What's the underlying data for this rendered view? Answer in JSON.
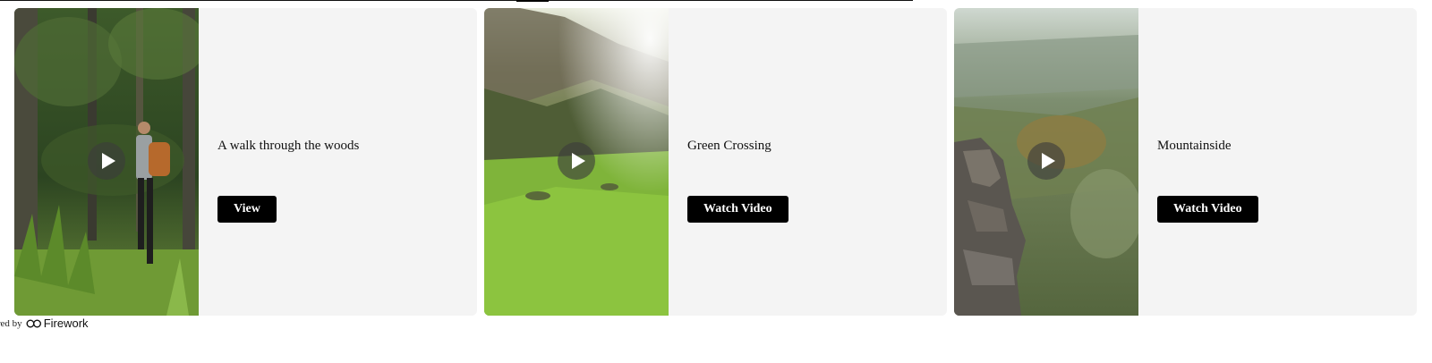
{
  "cards": [
    {
      "title": "A walk through the woods",
      "cta_label": "View",
      "thumbnail_icon": "forest-hiker-thumbnail"
    },
    {
      "title": "Green Crossing",
      "cta_label": "Watch Video",
      "thumbnail_icon": "green-hillside-thumbnail"
    },
    {
      "title": "Mountainside",
      "cta_label": "Watch Video",
      "thumbnail_icon": "mountain-valley-thumbnail"
    }
  ],
  "footer": {
    "powered_text": "ered by",
    "brand": "Firework"
  },
  "colors": {
    "card_bg": "#f4f4f4",
    "button_bg": "#000000",
    "button_text": "#ffffff"
  }
}
